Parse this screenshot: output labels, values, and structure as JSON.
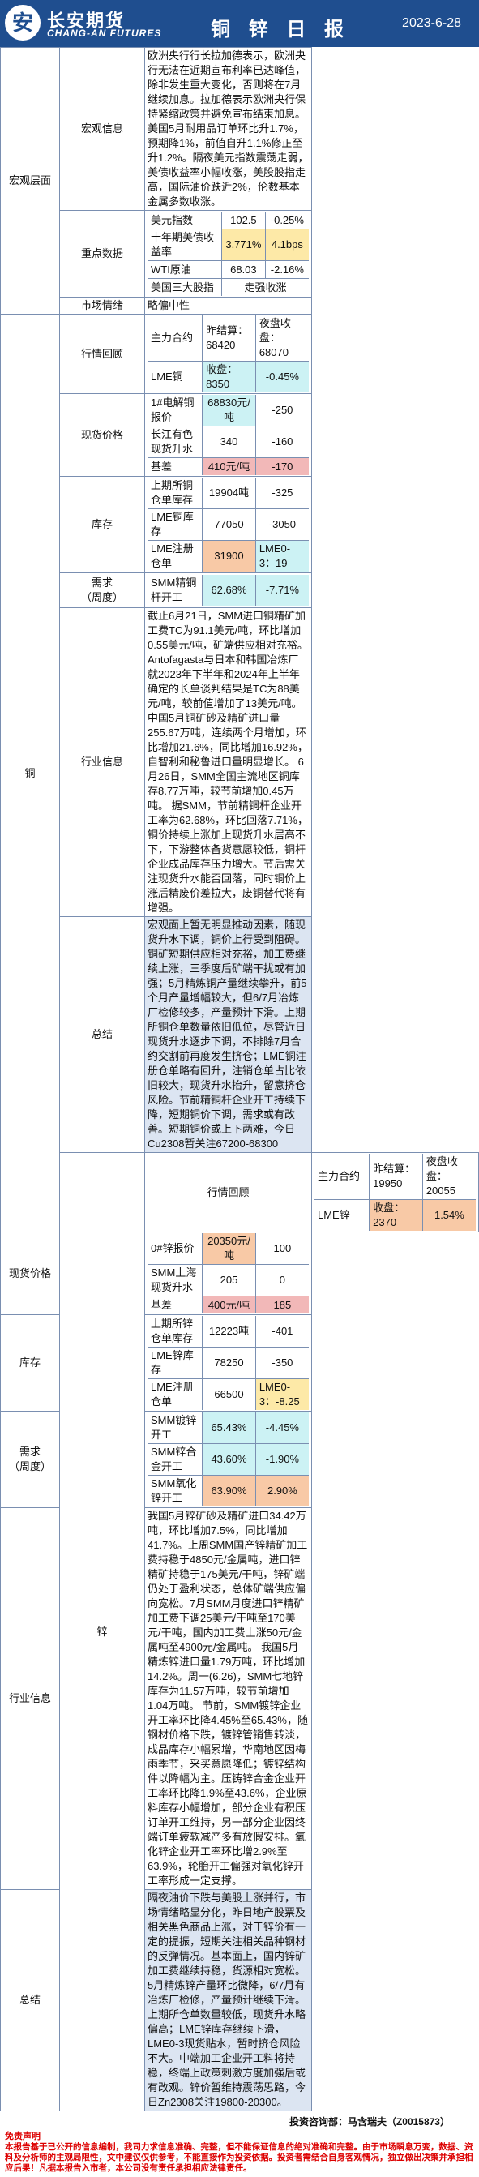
{
  "header": {
    "logo_glyph": "安",
    "brand_cn": "长安期货",
    "brand_en": "CHANG-AN FUTURES",
    "title": "铜 锌 日 报",
    "date": "2023-6-28"
  },
  "macro": {
    "section": "宏观层面",
    "info_label": "宏观信息",
    "info_text": "欧洲央行行长拉加德表示，欧洲央行无法在近期宣布利率已达峰值，除非发生重大变化，否则将在7月继续加息。拉加德表示欧洲央行保持紧缩政策并避免宣布结束加息。美国5月耐用品订单环比升1.7%，预期降1%，前值自升1.1%修正至升1.2%。隔夜美元指数震荡走弱，美债收益率小幅收涨，美股股指走高，国际油价跌近2%，伦数基本金属多数收涨。",
    "key_label": "重点数据",
    "key_rows": [
      {
        "name": "美元指数",
        "v1": "102.5",
        "v2": "-0.25%"
      },
      {
        "name": "十年期美债收益率",
        "v1": "3.771%",
        "v2": "4.1bps"
      },
      {
        "name": "WTI原油",
        "v1": "68.03",
        "v2": "-2.16%"
      },
      {
        "name": "美国三大股指",
        "v1": "走强收涨",
        "v2": ""
      }
    ],
    "sentiment_label": "市场情绪",
    "sentiment_value": "略偏中性"
  },
  "copper": {
    "section": "铜",
    "review_label": "行情回顾",
    "review_rows": [
      {
        "a": "主力合约",
        "b": "昨结算：68420",
        "c": "夜盘收盘：68070"
      },
      {
        "a": "LME铜",
        "b": "收盘：8350",
        "c": "-0.45%"
      }
    ],
    "spot_label": "现货价格",
    "spot_rows": [
      {
        "a": "1#电解铜报价",
        "b": "68830元/吨",
        "c": "-250"
      },
      {
        "a": "长江有色现货升水",
        "b": "340",
        "c": "-160"
      },
      {
        "a": "基差",
        "b": "410元/吨",
        "c": "-170"
      }
    ],
    "inv_label": "库存",
    "inv_rows": [
      {
        "a": "上期所铜仓单库存",
        "b": "19904吨",
        "c": "-325"
      },
      {
        "a": "LME铜库存",
        "b": "77050",
        "c": "-3050"
      },
      {
        "a": "LME注册仓单",
        "b": "31900",
        "c": "LME0-3：19"
      }
    ],
    "demand_label_1": "需求",
    "demand_label_2": "（周度）",
    "demand_rows": [
      {
        "a": "SMM精铜杆开工",
        "b": "62.68%",
        "c": "-7.71%"
      }
    ],
    "industry_label": "行业信息",
    "industry_text": "截止6月21日，SMM进口铜精矿加工费TC为91.1美元/吨，环比增加0.55美元/吨，矿端供应相对充裕。Antofagasta与日本和韩国冶炼厂就2023年下半年和2024年上半年确定的长单谈判结果是TC为88美元/吨，较前值增加了13美元/吨。中国5月铜矿砂及精矿进口量255.67万吨，连续两个月增加，环比增加21.6%，同比增加16.92%，自智利和秘鲁进口量明显增长。\n6月26日，SMM全国主流地区铜库存8.77万吨，较节前增加0.45万吨。\n据SMM，节前精铜杆企业开工率为62.68%，环比回落7.71%，铜价持续上涨加上现货升水居高不下，下游整体备货意愿较低，铜杆企业成品库存压力增大。节后需关注现货升水能否回落，同时铜价上涨后精废价差拉大，废铜替代将有增强。",
    "summary_label": "总结",
    "summary_text": "宏观面上暂无明显推动因素，随现货升水下调，铜价上行受到阻碍。铜矿短期供应相对充裕，加工费继续上涨，三季度后矿端干扰或有加强；5月精炼铜产量继续攀升，前5个月产量增幅较大，但6/7月冶炼厂检修较多，产量预计下滑。上期所铜仓单数量依旧低位，尽管近日现货升水逐步下调，不排除7月合约交割前再度发生挤仓；LME铜注册仓单略有回升，注销仓单占比依旧较大，现货升水抬升，留意挤仓风险。节前精铜杆企业开工持续下降，短期铜价下调，需求或有改善。短期铜价或上下两难，今日Cu2308暂关注67200-68300"
  },
  "zinc": {
    "section": "锌",
    "review_label": "行情回顾",
    "review_rows": [
      {
        "a": "主力合约",
        "b": "昨结算：19950",
        "c": "夜盘收盘：20055"
      },
      {
        "a": "LME锌",
        "b": "收盘：2370",
        "c": "1.54%"
      }
    ],
    "spot_label": "现货价格",
    "spot_rows": [
      {
        "a": "0#锌报价",
        "b": "20350元/吨",
        "c": "100"
      },
      {
        "a": "SMM上海现货升水",
        "b": "205",
        "c": "0"
      },
      {
        "a": "基差",
        "b": "400元/吨",
        "c": "185"
      }
    ],
    "inv_label": "库存",
    "inv_rows": [
      {
        "a": "上期所锌仓单库存",
        "b": "12223吨",
        "c": "-401"
      },
      {
        "a": "LME锌库存",
        "b": "78250",
        "c": "-350"
      },
      {
        "a": "LME注册仓单",
        "b": "66500",
        "c": "LME0-3：-8.25"
      }
    ],
    "demand_label_1": "需求",
    "demand_label_2": "（周度）",
    "demand_rows": [
      {
        "a": "SMM镀锌开工",
        "b": "65.43%",
        "c": "-4.45%"
      },
      {
        "a": "SMM锌合金开工",
        "b": "43.60%",
        "c": "-1.90%"
      },
      {
        "a": "SMM氧化锌开工",
        "b": "63.90%",
        "c": "2.90%"
      }
    ],
    "industry_label": "行业信息",
    "industry_text": "我国5月锌矿砂及精矿进口34.42万吨，环比增加7.5%，同比增加41.7%。上周SMM国产锌精矿加工费持稳于4850元/金属吨，进口锌精矿持稳于175美元/干吨，锌矿端仍处于盈利状态，总体矿端供应偏向宽松。7月SMM月度进口锌精矿加工费下调25美元/干吨至170美元/干吨，国内加工费上涨50元/金属吨至4900元/金属吨。\n我国5月精炼锌进口量1.79万吨，环比增加14.2%。周一(6.26)，SMM七地锌库存为11.57万吨，较节前增加1.04万吨。\n节前，SMM镀锌企业开工率环比降4.45%至65.43%，随钢材价格下跌，镀锌管销售转淡，成品库存小幅累增，华南地区因梅雨季节，采买意愿降低；镀锌结构件以降幅为主。压铸锌合金企业开工率环比降1.9%至43.6%，企业原料库存小幅增加，部分企业有积压订单开工维持，另一部分企业因终端订单疲软减产多有放假安排。氧化锌企业开工率环比增2.9%至63.9%，轮胎开工偏强对氧化锌开工率形成一定支撑。",
    "summary_label": "总结",
    "summary_text": "隔夜油价下跌与美股上涨并行，市场情绪略显分化，昨日地产股票及相关黑色商品上涨，对于锌价有一定的提振，短期关注相关品种钢材的反弹情况。基本面上，国内锌矿加工费继续持稳，货源相对宽松。5月精炼锌产量环比微降，6/7月有冶炼厂检修，产量预计继续下滑。上期所仓单数量较低，现货升水略偏高；LME锌库存继续下滑，LME0-3现货贴水，暂时挤仓风险不大。中端加工企业开工料将持稳，终端上政策刺激方度加强后或有改观。锌价暂维持震荡思路，今日Zn2308关注19800-20300。"
  },
  "footer": {
    "analyst": "投资咨询部：马含瑞夫（Z0015873）",
    "disclaimer_title": "免责声明",
    "disclaimer_text": "本报告基于已公开的信息编制，我司力求信息准确、完整，但不能保证信息的绝对准确和完整。由于市场瞬息万变，数据、资料及分析师的主观局限性，文中建议仅供参考，不能直接作为投资依据。投资者需结合自身客观情况，独立做出决策并承担相应后果！凡据本报告入市者，本公司没有责任承担相应法律责任。"
  }
}
